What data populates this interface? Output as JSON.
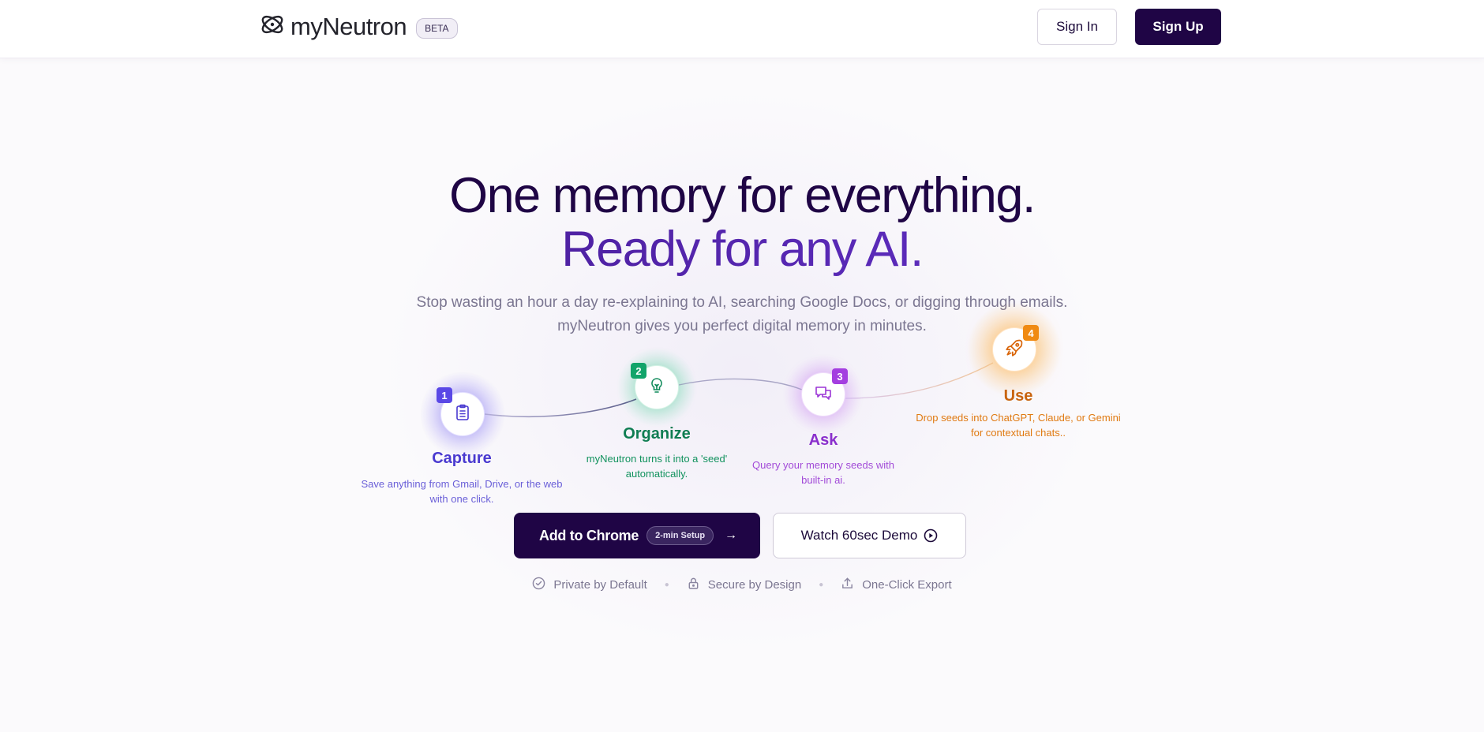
{
  "header": {
    "brand": "myNeutron",
    "badge": "BETA",
    "signin_label": "Sign In",
    "signup_label": "Sign Up"
  },
  "hero": {
    "title_line1": "One memory for everything.",
    "title_line2": "Ready for any AI.",
    "subtitle_line1": "Stop wasting an hour a day re-explaining to AI, searching Google Docs, or digging through emails.",
    "subtitle_line2": "myNeutron gives you perfect digital memory in minutes."
  },
  "steps": [
    {
      "number": "1",
      "title": "Capture",
      "desc_line1": "Save anything from Gmail, Drive, or the web",
      "desc_line2": "with one click.",
      "icon": "clipboard-icon",
      "color": "#4a3ad0"
    },
    {
      "number": "2",
      "title": "Organize",
      "desc_line1": "myNeutron turns it into a 'seed'",
      "desc_line2": "automatically.",
      "icon": "lightbulb-icon",
      "color": "#0f8a5a"
    },
    {
      "number": "3",
      "title": "Ask",
      "desc_line1": "Query your memory seeds with",
      "desc_line2": "built-in ai.",
      "icon": "chat-bubbles-icon",
      "color": "#9b35d6"
    },
    {
      "number": "4",
      "title": "Use",
      "desc_line1": "Drop seeds into ChatGPT, Claude, or Gemini",
      "desc_line2": "for contextual chats..",
      "icon": "rocket-icon",
      "color": "#d9660a"
    }
  ],
  "cta": {
    "primary_label": "Add to Chrome",
    "primary_pill": "2-min Setup",
    "secondary_label": "Watch 60sec Demo"
  },
  "trust": {
    "item1": "Private by Default",
    "item2": "Secure by Design",
    "item3": "One-Click Export"
  }
}
